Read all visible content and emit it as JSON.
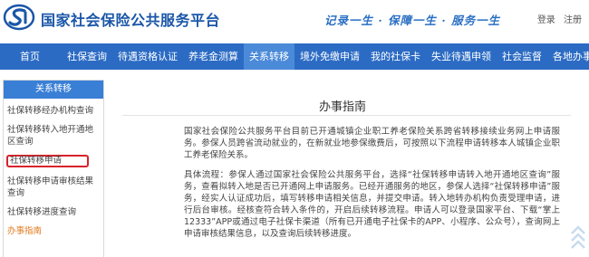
{
  "header": {
    "site_title": "国家社会保险公共服务平台",
    "slogan": "记录一生 · 保障一生 · 服务一生",
    "login": "登录",
    "register": "注册",
    "brand_color": "#1a56a8"
  },
  "nav": {
    "items": [
      "首页",
      "社保查询",
      "待遇资格认证",
      "养老金测算",
      "关系转移",
      "境外免缴申请",
      "我的社保卡",
      "失业待遇申领",
      "社会监督",
      "各地办事大厅"
    ],
    "active_index": 4,
    "bar_color": "#2b6bc4"
  },
  "sidebar": {
    "heading": "关系转移",
    "items": [
      "社保转移经办机构查询",
      "社保转移转入地开通地区查询",
      "社保转移申请",
      "社保转移申请审核结果查询",
      "社保转移进度查询",
      "办事指南"
    ],
    "highlighted_index": 2,
    "active_index": 5
  },
  "main": {
    "title": "办事指南",
    "paragraph1": "国家社会保险公共服务平台目前已开通城镇企业职工养老保险关系跨省转移接续业务网上申请服务。参保人员跨省流动就业的，在新就业地参保缴费后，可按照以下流程申请转移本人城镇企业职工养老保险关系。",
    "paragraph2": "具体流程：参保人通过国家社会保险公共服务平台，选择“社保转移申请转入地开通地区查询”服务，查看拟转入地是否已开通网上申请服务。已经开通服务的地区，参保人选择“社保转移申请”服务，经实人认证成功后，填写转移申请相关信息，并提交申请。转入地转办机构负责受理申请，进行后台审核。经核查符合转入条件的，开启后续转移流程。申请人可以登录国家平台、下载“掌上12333”APP或通过电子社保卡渠道（所有已开通电子社保卡的APP、小程序、公众号），查询网上申请审核结果信息，以及查询后续转移进度。"
  }
}
